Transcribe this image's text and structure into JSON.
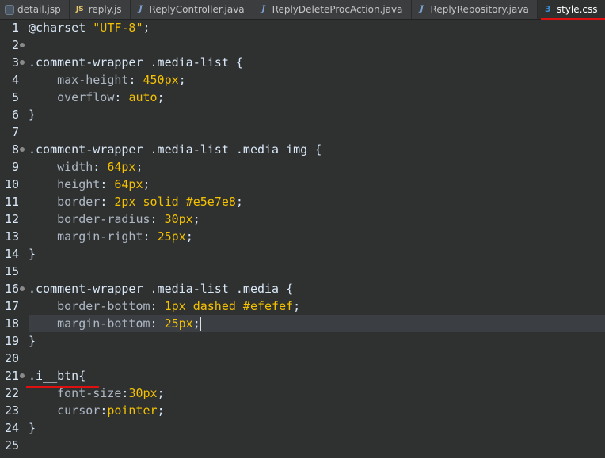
{
  "tabs": [
    {
      "label": "detail.jsp",
      "icon": "jsp-file-icon",
      "active": false
    },
    {
      "label": "reply.js",
      "icon": "js-file-icon",
      "active": false
    },
    {
      "label": "ReplyController.java",
      "icon": "java-file-icon",
      "active": false
    },
    {
      "label": "ReplyDeleteProcAction.java",
      "icon": "java-file-icon",
      "active": false
    },
    {
      "label": "ReplyRepository.java",
      "icon": "java-file-icon",
      "active": false
    },
    {
      "label": "style.css",
      "icon": "css-file-icon",
      "active": true,
      "close": "✕"
    }
  ],
  "icons": {
    "jsp": "",
    "js": "JS",
    "java": "J",
    "css": "3"
  },
  "lines": [
    {
      "n": "1",
      "fold": false,
      "tokens": [
        {
          "t": "@charset ",
          "c": "at"
        },
        {
          "t": "\"UTF-8\"",
          "c": "str"
        },
        {
          "t": ";",
          "c": "sel"
        }
      ]
    },
    {
      "n": "2",
      "fold": true,
      "tokens": []
    },
    {
      "n": "3",
      "fold": true,
      "tokens": [
        {
          "t": ".comment-wrapper .media-list {",
          "c": "sel"
        }
      ]
    },
    {
      "n": "4",
      "fold": false,
      "tokens": [
        {
          "t": "    max-height",
          "c": "prop"
        },
        {
          "t": ": ",
          "c": "sel"
        },
        {
          "t": "450px",
          "c": "val"
        },
        {
          "t": ";",
          "c": "sel"
        }
      ]
    },
    {
      "n": "5",
      "fold": false,
      "tokens": [
        {
          "t": "    overflow",
          "c": "prop"
        },
        {
          "t": ": ",
          "c": "sel"
        },
        {
          "t": "auto",
          "c": "val"
        },
        {
          "t": ";",
          "c": "sel"
        }
      ]
    },
    {
      "n": "6",
      "fold": false,
      "tokens": [
        {
          "t": "}",
          "c": "sel"
        }
      ]
    },
    {
      "n": "7",
      "fold": false,
      "tokens": []
    },
    {
      "n": "8",
      "fold": true,
      "tokens": [
        {
          "t": ".comment-wrapper .media-list .media img {",
          "c": "sel"
        }
      ]
    },
    {
      "n": "9",
      "fold": false,
      "tokens": [
        {
          "t": "    width",
          "c": "prop"
        },
        {
          "t": ": ",
          "c": "sel"
        },
        {
          "t": "64px",
          "c": "val"
        },
        {
          "t": ";",
          "c": "sel"
        }
      ]
    },
    {
      "n": "10",
      "fold": false,
      "tokens": [
        {
          "t": "    height",
          "c": "prop"
        },
        {
          "t": ": ",
          "c": "sel"
        },
        {
          "t": "64px",
          "c": "val"
        },
        {
          "t": ";",
          "c": "sel"
        }
      ]
    },
    {
      "n": "11",
      "fold": false,
      "tokens": [
        {
          "t": "    border",
          "c": "prop"
        },
        {
          "t": ": ",
          "c": "sel"
        },
        {
          "t": "2px solid #e5e7e8",
          "c": "val"
        },
        {
          "t": ";",
          "c": "sel"
        }
      ]
    },
    {
      "n": "12",
      "fold": false,
      "tokens": [
        {
          "t": "    border-radius",
          "c": "prop"
        },
        {
          "t": ": ",
          "c": "sel"
        },
        {
          "t": "30px",
          "c": "val"
        },
        {
          "t": ";",
          "c": "sel"
        }
      ]
    },
    {
      "n": "13",
      "fold": false,
      "tokens": [
        {
          "t": "    margin-right",
          "c": "prop"
        },
        {
          "t": ": ",
          "c": "sel"
        },
        {
          "t": "25px",
          "c": "val"
        },
        {
          "t": ";",
          "c": "sel"
        }
      ]
    },
    {
      "n": "14",
      "fold": false,
      "tokens": [
        {
          "t": "}",
          "c": "sel"
        }
      ]
    },
    {
      "n": "15",
      "fold": false,
      "tokens": []
    },
    {
      "n": "16",
      "fold": true,
      "tokens": [
        {
          "t": ".comment-wrapper .media-list .media {",
          "c": "sel"
        }
      ]
    },
    {
      "n": "17",
      "fold": false,
      "tokens": [
        {
          "t": "    border-bottom",
          "c": "prop"
        },
        {
          "t": ": ",
          "c": "sel"
        },
        {
          "t": "1px dashed #efefef",
          "c": "val"
        },
        {
          "t": ";",
          "c": "sel"
        }
      ]
    },
    {
      "n": "18",
      "fold": false,
      "current": true,
      "tokens": [
        {
          "t": "    margin-bottom",
          "c": "prop"
        },
        {
          "t": ": ",
          "c": "sel"
        },
        {
          "t": "25px",
          "c": "val"
        },
        {
          "t": ";",
          "c": "sel"
        }
      ]
    },
    {
      "n": "19",
      "fold": false,
      "tokens": [
        {
          "t": "}",
          "c": "sel"
        }
      ]
    },
    {
      "n": "20",
      "fold": false,
      "tokens": []
    },
    {
      "n": "21",
      "fold": true,
      "tokens": [
        {
          "t": ".i__btn{",
          "c": "sel"
        }
      ]
    },
    {
      "n": "22",
      "fold": false,
      "tokens": [
        {
          "t": "    font-size",
          "c": "prop"
        },
        {
          "t": ":",
          "c": "sel"
        },
        {
          "t": "30px",
          "c": "val"
        },
        {
          "t": ";",
          "c": "sel"
        }
      ]
    },
    {
      "n": "23",
      "fold": false,
      "tokens": [
        {
          "t": "    cursor",
          "c": "prop"
        },
        {
          "t": ":",
          "c": "sel"
        },
        {
          "t": "pointer",
          "c": "val"
        },
        {
          "t": ";",
          "c": "sel"
        }
      ]
    },
    {
      "n": "24",
      "fold": false,
      "tokens": [
        {
          "t": "}",
          "c": "sel"
        }
      ]
    },
    {
      "n": "25",
      "fold": false,
      "tokens": []
    }
  ],
  "colors": {
    "background": "#2f3030",
    "value": "#f5c200",
    "property": "#aeb8c4",
    "text": "#d9e8f7",
    "annotation": "#e01010"
  }
}
